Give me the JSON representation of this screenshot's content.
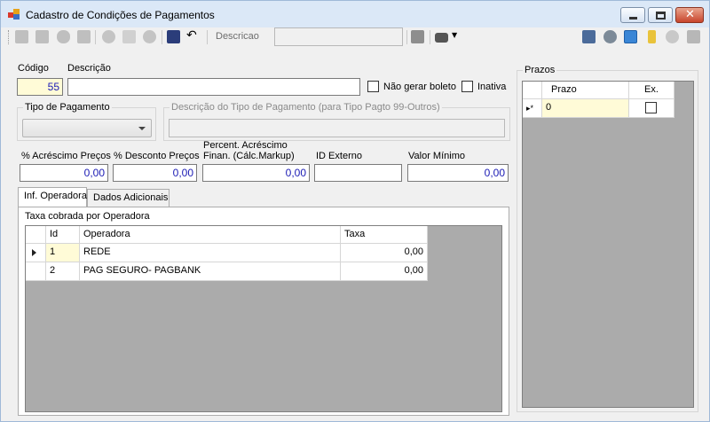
{
  "window": {
    "title": "Cadastro de Condições de Pagamentos"
  },
  "toolbar": {
    "search_label": "Descricao",
    "search_value": "",
    "icons": [
      "first-icon",
      "previous-icon",
      "next-icon",
      "last-icon",
      "add-icon",
      "edit-icon",
      "cancel-icon",
      "save-icon",
      "undo-icon",
      "grid-view-icon",
      "print-icon",
      "report-icon",
      "settings-icon",
      "refresh-icon",
      "pin-icon",
      "user-icon"
    ]
  },
  "form": {
    "codigo_label": "Código",
    "codigo_value": "55",
    "descricao_label": "Descrição",
    "descricao_value": "",
    "nao_gerar_boleto_label": "Não gerar boleto",
    "inativa_label": "Inativa",
    "tipo_pagamento_title": "Tipo de Pagamento",
    "tipo_pagamento_value": "",
    "descricao_tipo_title": "Descrição do Tipo de Pagamento (para Tipo Pagto 99-Outros)",
    "descricao_tipo_value": "",
    "acrescimo_label": "% Acréscimo Preços",
    "acrescimo_value": "0,00",
    "desconto_label": "% Desconto Preços",
    "desconto_value": "0,00",
    "percent_acrescimo_label_1": "Percent. Acréscimo",
    "percent_acrescimo_label_2": "Finan. (Cálc.Markup)",
    "percent_acrescimo_value": "0,00",
    "id_externo_label": "ID Externo",
    "id_externo_value": "",
    "valor_minimo_label": "Valor Mínimo",
    "valor_minimo_value": "0,00"
  },
  "tabs": [
    {
      "label": "Inf. Operadora"
    },
    {
      "label": "Dados Adicionais"
    }
  ],
  "operadora": {
    "caption": "Taxa cobrada por Operadora",
    "columns": [
      "Id",
      "Operadora",
      "Taxa"
    ],
    "rows": [
      {
        "id": "1",
        "operadora": "REDE",
        "taxa": "0,00"
      },
      {
        "id": "2",
        "operadora": "PAG SEGURO- PAGBANK",
        "taxa": "0,00"
      }
    ]
  },
  "prazos": {
    "title": "Prazos",
    "columns": [
      "Prazo",
      "Ex."
    ],
    "new_row_marker": "▸*",
    "rows": [
      {
        "prazo": "0",
        "ex": false
      }
    ]
  }
}
